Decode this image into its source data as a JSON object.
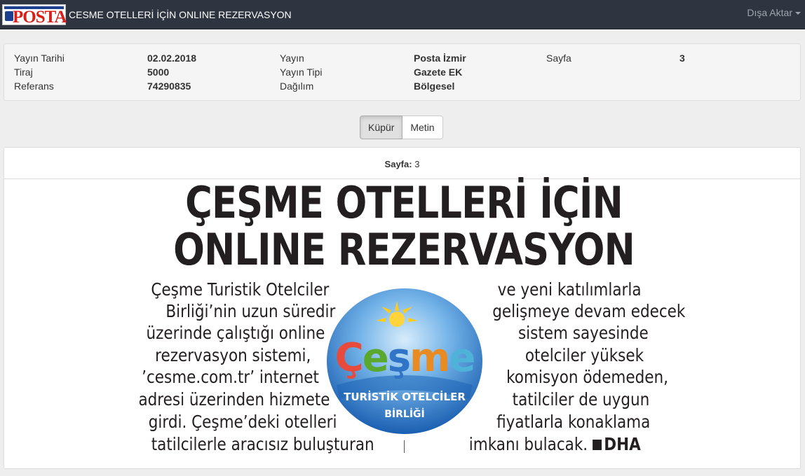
{
  "navbar": {
    "logo_text": "POSTA",
    "title": "CESME OTELLERİ İÇİN ONLINE REZERVASYON",
    "export_label": "Dışa Aktar"
  },
  "info": {
    "yayin_tarihi_label": "Yayın Tarihi",
    "yayin_tarihi_value": "02.02.2018",
    "tiraj_label": "Tiraj",
    "tiraj_value": "5000",
    "referans_label": "Referans",
    "referans_value": "74290835",
    "yayin_label": "Yayın",
    "yayin_value": "Posta İzmir",
    "yayin_tipi_label": "Yayın Tipi",
    "yayin_tipi_value": "Gazete EK",
    "dagilim_label": "Dağılım",
    "dagilim_value": "Bölgesel",
    "sayfa_label": "Sayfa",
    "sayfa_value": "3"
  },
  "view_tabs": {
    "kupur": "Küpür",
    "metin": "Metin",
    "active": "Küpür"
  },
  "clip": {
    "page_label": "Sayfa:",
    "page_value": "3",
    "headline_line1": "ÇEŞME OTELLERİ İÇİN",
    "headline_line2": "ONLINE REZERVASYON",
    "left_lines": [
      "Çeşme Turistik Otelciler",
      "Birliği’nin uzun süredir",
      "üzerinde çalıştığı online",
      "rezervasyon sistemi,",
      "’cesme.com.tr’ internet",
      "adresi üzerinden hizmete",
      "girdi. Çeşme’deki otelleri",
      "tatilcilerle aracısız buluşturan"
    ],
    "right_lines": [
      "ve yeni katılımlarla",
      "gelişmeye devam edecek",
      "sistem sayesinde",
      "otelciler yüksek",
      "komisyon ödemeden,",
      "tatilciler de uygun",
      "fiyatlarla konaklama",
      "imkanı bulacak."
    ],
    "byline": "DHA",
    "emblem": {
      "wordmark": "Çeşme",
      "line1": "TURİSTİK OTELCİLER",
      "line2": "BİRLİĞİ",
      "colors": {
        "sky": "#3f86d0",
        "sea": "#1c62b4",
        "sun": "#ffd43a",
        "c": "#e84a3c",
        "e": "#5ba82e",
        "s": "#2f74c6",
        "m": "#e98b23",
        "e2": "#4fb3d9"
      }
    }
  }
}
